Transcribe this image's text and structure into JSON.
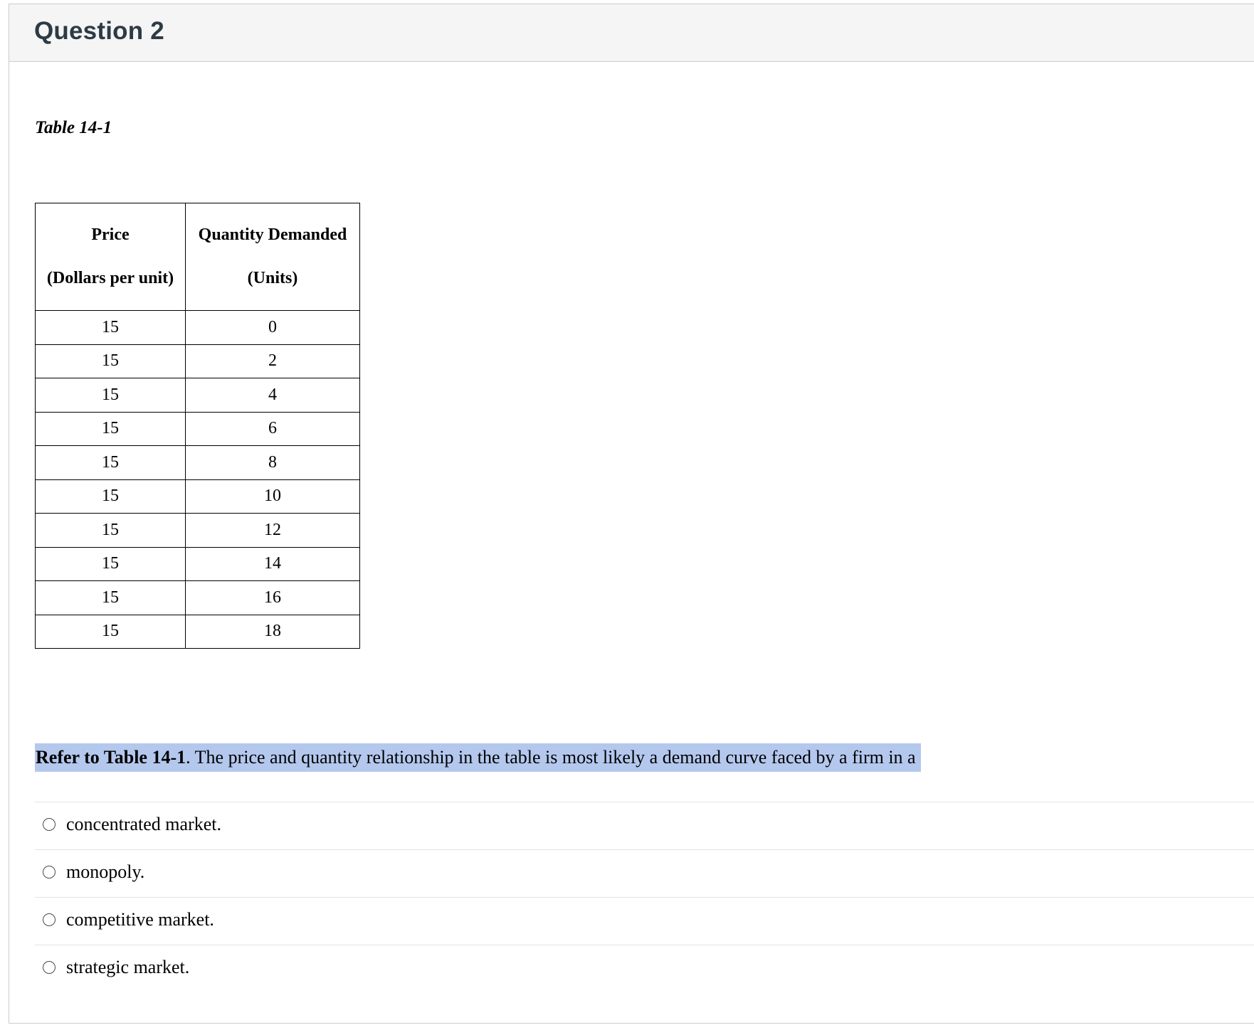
{
  "question": {
    "title": "Question 2"
  },
  "table": {
    "caption": "Table 14-1",
    "headers": [
      {
        "line1": "Price",
        "line2": "(Dollars per unit)"
      },
      {
        "line1": "Quantity Demanded",
        "line2": "(Units)"
      }
    ],
    "rows": [
      [
        "15",
        "0"
      ],
      [
        "15",
        "2"
      ],
      [
        "15",
        "4"
      ],
      [
        "15",
        "6"
      ],
      [
        "15",
        "8"
      ],
      [
        "15",
        "10"
      ],
      [
        "15",
        "12"
      ],
      [
        "15",
        "14"
      ],
      [
        "15",
        "16"
      ],
      [
        "15",
        "18"
      ]
    ]
  },
  "prompt": {
    "ref": "Refer to Table 14-1",
    "text": ". The price and quantity relationship in the table is most likely a demand curve faced by a firm in a",
    "highlight_color": "#b4c8ee"
  },
  "answers": [
    {
      "label": "concentrated market."
    },
    {
      "label": "monopoly."
    },
    {
      "label": "competitive market."
    },
    {
      "label": "strategic market."
    }
  ]
}
